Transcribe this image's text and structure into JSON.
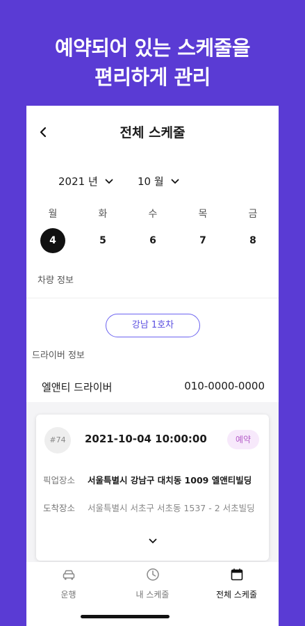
{
  "promo": {
    "line1": "예약되어 있는 스케줄을",
    "line2": "편리하게 관리"
  },
  "header": {
    "title": "전체 스케줄"
  },
  "selectors": {
    "year": "2021 년",
    "month": "10 월"
  },
  "week": [
    {
      "name": "월",
      "date": "4",
      "selected": true
    },
    {
      "name": "화",
      "date": "5",
      "selected": false
    },
    {
      "name": "수",
      "date": "6",
      "selected": false
    },
    {
      "name": "목",
      "date": "7",
      "selected": false
    },
    {
      "name": "금",
      "date": "8",
      "selected": false
    }
  ],
  "vehicle": {
    "section_label": "차량 정보",
    "chip_label": "강남 1호차"
  },
  "driver": {
    "section_label": "드라이버 정보",
    "name": "엘앤티 드라이버",
    "phone": "010-0000-0000"
  },
  "reservation": {
    "number": "#74",
    "datetime": "2021-10-04 10:00:00",
    "status": "예약",
    "pickup_label": "픽업장소",
    "pickup_value": "서울특별시 강남구 대치동 1009 엘앤티빌딩",
    "dropoff_label": "도착장소",
    "dropoff_value": "서울특별시 서초구 서초동 1537 - 2 서초빌딩"
  },
  "tabs": [
    {
      "label": "운행",
      "icon": "car-icon",
      "active": false
    },
    {
      "label": "내 스케줄",
      "icon": "clock-icon",
      "active": false
    },
    {
      "label": "전체 스케줄",
      "icon": "calendar-icon",
      "active": true
    }
  ],
  "colors": {
    "background": "#5a3bd4",
    "accent": "#6b62f0",
    "status_bg": "#f7e9fb",
    "status_text": "#b45cc8"
  }
}
